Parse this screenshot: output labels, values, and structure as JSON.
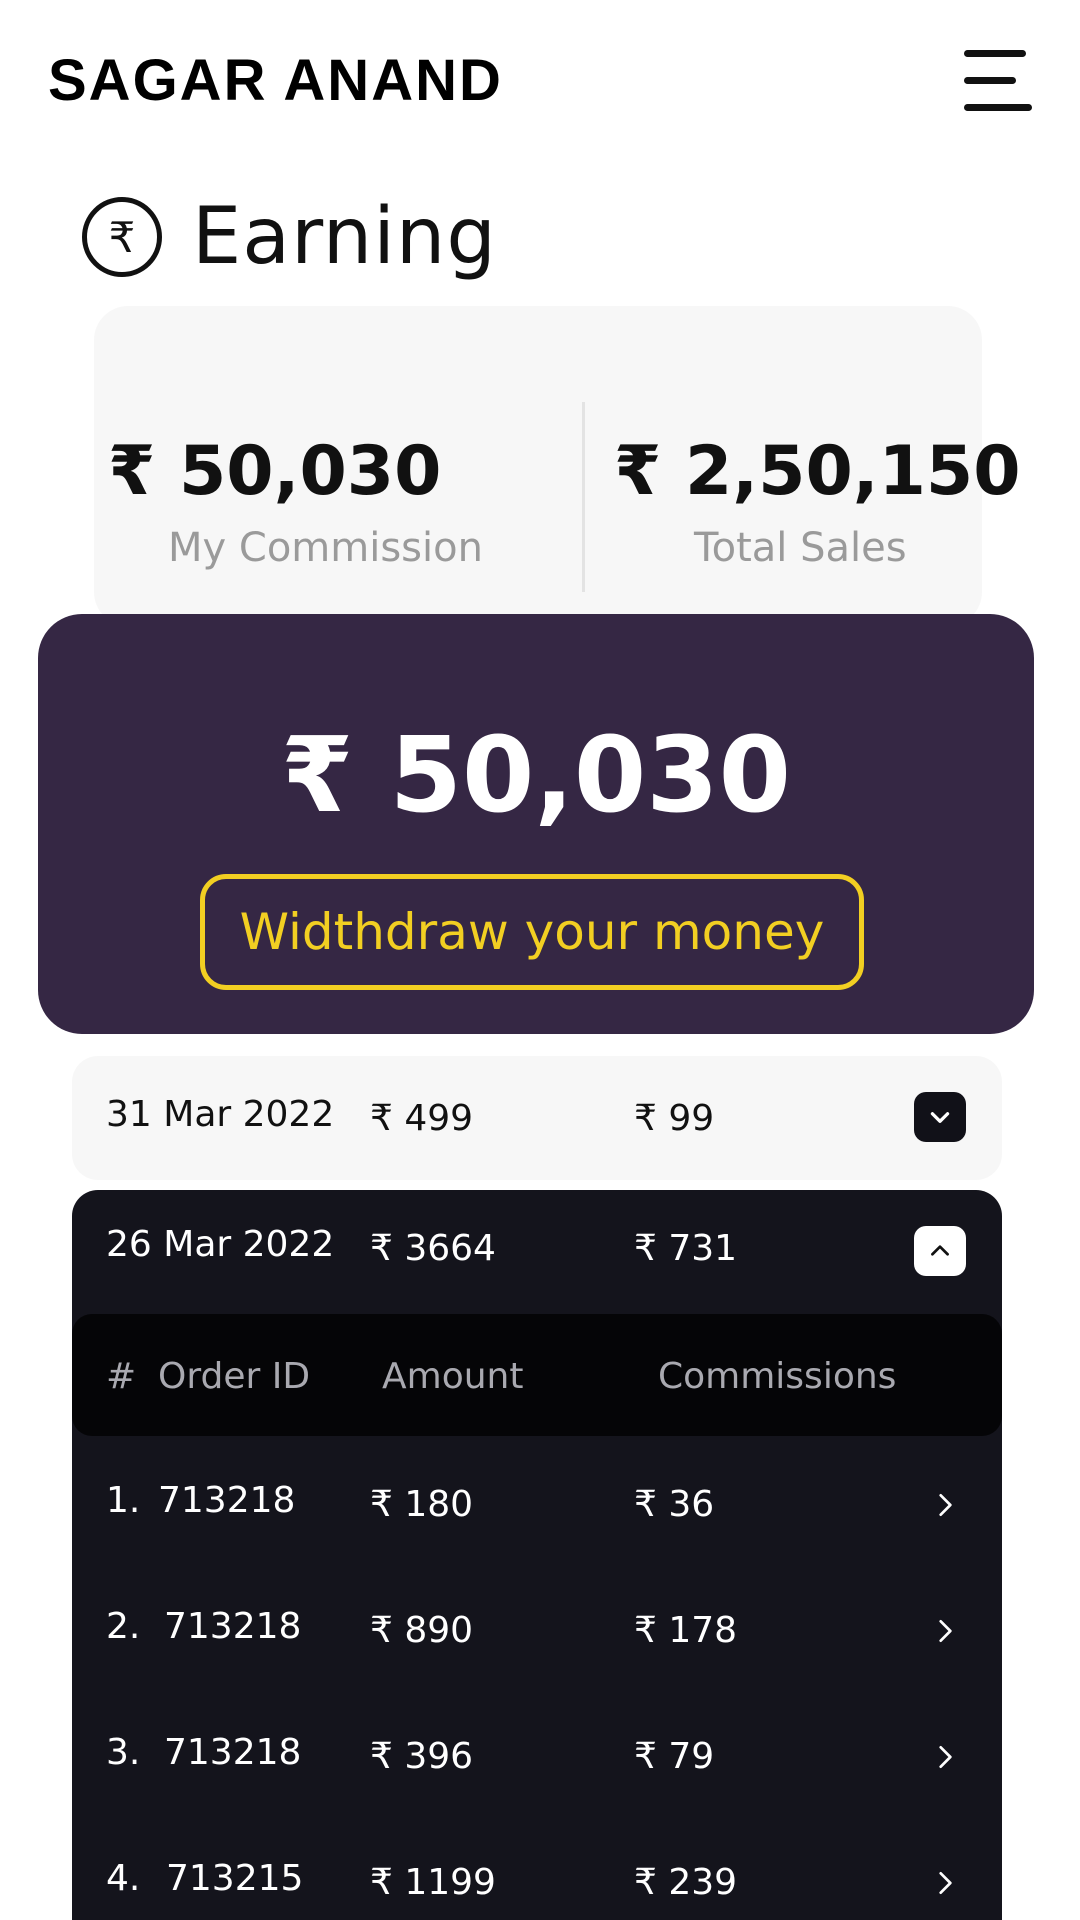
{
  "header": {
    "brand": "SAGAR ANAND",
    "menu_icon": "hamburger-menu-icon"
  },
  "earning": {
    "icon": "rupee-circle-icon",
    "icon_glyph": "₹",
    "title": "Earning"
  },
  "stats": {
    "commission_value": "₹ 50,030",
    "commission_label": "My Commission",
    "sales_value": "₹ 2,50,150",
    "sales_label": "Total Sales"
  },
  "withdraw": {
    "amount": "₹ 50,030",
    "button_label": "Widthdraw your money"
  },
  "days": [
    {
      "date": "31 Mar 2022",
      "amount": "₹ 499",
      "commission": "₹ 99",
      "expanded": false,
      "toggle_icon": "chevron-down-icon"
    },
    {
      "date": "26 Mar 2022",
      "amount": "₹ 3664",
      "commission": "₹ 731",
      "expanded": true,
      "toggle_icon": "chevron-up-icon",
      "table_headers": {
        "index": "#",
        "order_id": "Order ID",
        "amount": "Amount",
        "commissions": "Commissions"
      },
      "orders": [
        {
          "index": "1.",
          "order_id": "713218",
          "amount": "₹ 180",
          "commission": "₹ 36"
        },
        {
          "index": "2.",
          "order_id": "713218",
          "amount": "₹ 890",
          "commission": "₹ 178"
        },
        {
          "index": "3.",
          "order_id": "713218",
          "amount": "₹ 396",
          "commission": "₹ 79"
        },
        {
          "index": "4.",
          "order_id": "713215",
          "amount": "₹ 1199",
          "commission": "₹ 239"
        }
      ]
    }
  ],
  "colors": {
    "purple_card": "#352744",
    "accent_yellow": "#f2cf22",
    "dark_block": "#14141c"
  }
}
